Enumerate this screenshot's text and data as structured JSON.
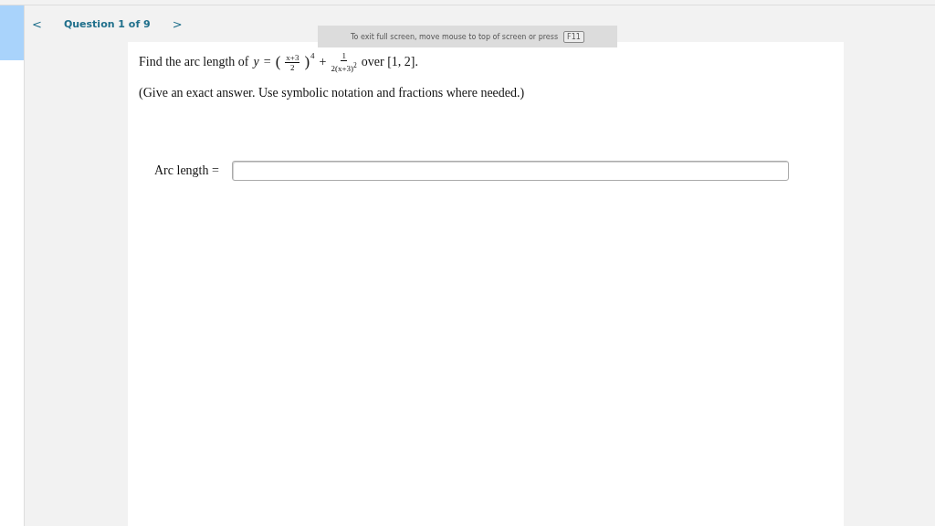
{
  "nav": {
    "prev": "<",
    "label": "Question 1 of 9",
    "next": ">"
  },
  "toast": {
    "text": "To exit full screen, move mouse to top of screen or press",
    "key": "F11"
  },
  "question": {
    "prefix": "Find the arc length of",
    "variable": "y",
    "equals": "=",
    "open_paren": "(",
    "close_paren": ")",
    "fraction_1": {
      "numerator": "x+3",
      "denominator": "2"
    },
    "exponent": "4",
    "plus": "+",
    "fraction_2": {
      "numerator": "1",
      "denominator": "2(x+3)$^{2}$"
    },
    "suffix": "over [1, 2]."
  },
  "instruction": "(Give an exact answer. Use symbolic notation and fractions where needed.)",
  "answer": {
    "label": "Arc length ="
  }
}
